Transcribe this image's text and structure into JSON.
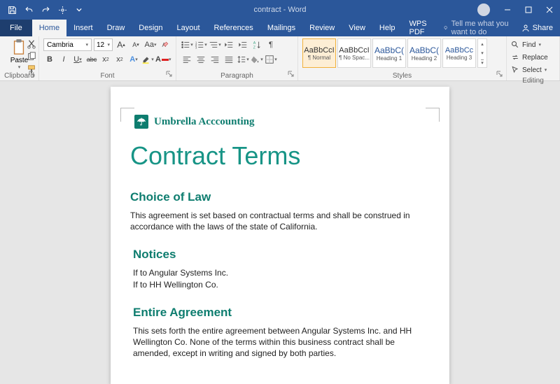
{
  "titlebar": {
    "title": "contract - Word",
    "user": ""
  },
  "menu": {
    "file": "File",
    "tabs": [
      "Home",
      "Insert",
      "Draw",
      "Design",
      "Layout",
      "References",
      "Mailings",
      "Review",
      "View",
      "Help",
      "WPS PDF"
    ],
    "tell_me": "Tell me what you want to do",
    "share": "Share"
  },
  "ribbon": {
    "clipboard": {
      "label": "Clipboard",
      "paste": "Paste"
    },
    "font": {
      "label": "Font",
      "name": "Cambria",
      "size": "12",
      "grow": "A",
      "shrink": "A",
      "case": "Aa",
      "clear": "A",
      "bold": "B",
      "italic": "I",
      "underline": "U",
      "strike": "abc",
      "sub": "x",
      "sup": "x",
      "effects": "A",
      "highlight": "",
      "color": "A"
    },
    "paragraph": {
      "label": "Paragraph"
    },
    "styles": {
      "label": "Styles",
      "items": [
        {
          "preview": "AaBbCcI",
          "name": "¶ Normal"
        },
        {
          "preview": "AaBbCcI",
          "name": "¶ No Spac..."
        },
        {
          "preview": "AaBbC(",
          "name": "Heading 1"
        },
        {
          "preview": "AaBbC(",
          "name": "Heading 2"
        },
        {
          "preview": "AaBbCc",
          "name": "Heading 3"
        }
      ]
    },
    "editing": {
      "label": "Editing",
      "find": "Find",
      "replace": "Replace",
      "select": "Select"
    }
  },
  "document": {
    "brand": "Umbrella Acccounting",
    "title": "Contract Terms",
    "sections": [
      {
        "heading": "Choice of Law",
        "body": "This agreement is set based on contractual terms and shall be construed in accordance with the laws of the state of California."
      },
      {
        "heading": "Notices",
        "body": "If to Angular Systems Inc.\nIf to HH Wellington Co."
      },
      {
        "heading": "Entire Agreement",
        "body": "This sets forth the entire agreement between Angular Systems Inc. and HH Wellington Co. None of the terms within this business contract shall be amended, except in writing and signed by both parties."
      }
    ]
  }
}
